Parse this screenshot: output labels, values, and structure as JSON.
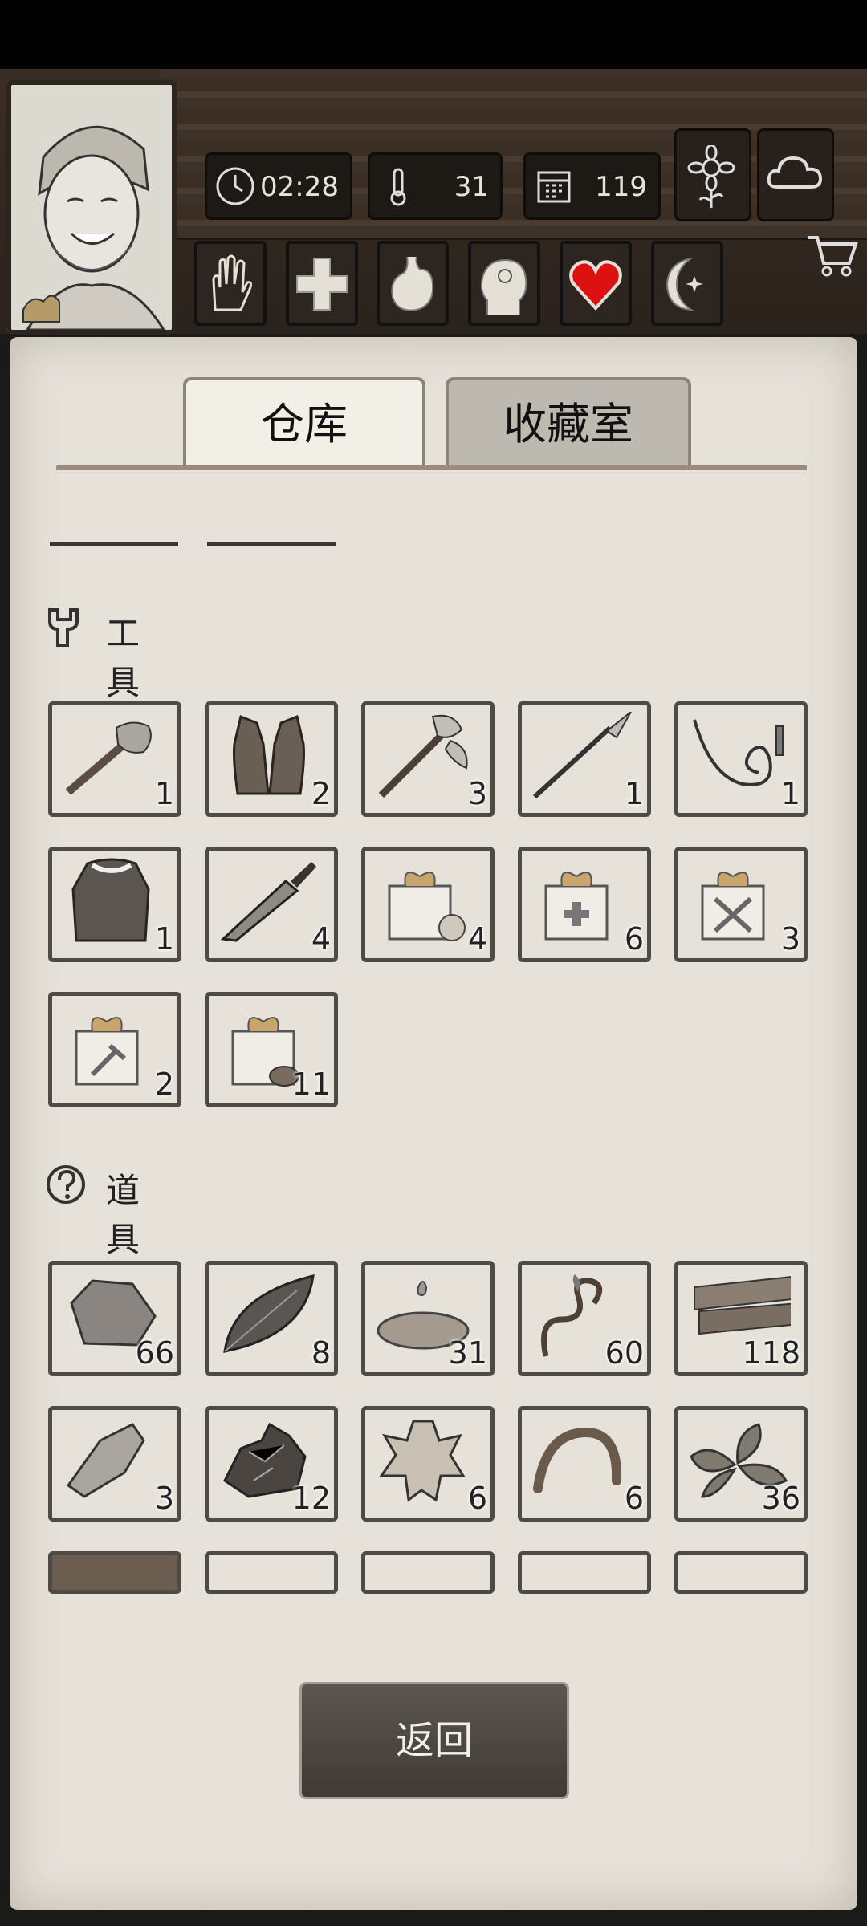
{
  "hud": {
    "time": "02:28",
    "temperature": "31",
    "days": "119",
    "top_buttons": [
      "sunflower-icon",
      "cloud-icon"
    ],
    "status_icons": [
      "hand-icon",
      "medical-cross-icon",
      "stomach-icon",
      "head-icon",
      "heart-icon",
      "moon-star-icon"
    ]
  },
  "tabs": {
    "warehouse": "仓库",
    "collection": "收藏室"
  },
  "sections": {
    "tools": {
      "title": "工具",
      "items": [
        {
          "icon": "stone-axe-icon",
          "count": "1"
        },
        {
          "icon": "leather-vest-icon",
          "count": "2"
        },
        {
          "icon": "battle-axe-icon",
          "count": "3"
        },
        {
          "icon": "spear-icon",
          "count": "1"
        },
        {
          "icon": "whip-icon",
          "count": "1"
        },
        {
          "icon": "fur-coat-icon",
          "count": "1"
        },
        {
          "icon": "machete-icon",
          "count": "4"
        },
        {
          "icon": "food-gift-box-icon",
          "count": "4"
        },
        {
          "icon": "medical-gift-box-icon",
          "count": "6"
        },
        {
          "icon": "weapon-gift-box-icon",
          "count": "3"
        },
        {
          "icon": "tool-gift-box-icon",
          "count": "2"
        },
        {
          "icon": "wood-gift-box-icon",
          "count": "11"
        }
      ]
    },
    "props": {
      "title": "道具",
      "items": [
        {
          "icon": "stone-icon",
          "count": "66"
        },
        {
          "icon": "leaf-icon",
          "count": "8"
        },
        {
          "icon": "water-puddle-icon",
          "count": "31"
        },
        {
          "icon": "vine-icon",
          "count": "60"
        },
        {
          "icon": "wood-planks-icon",
          "count": "118"
        },
        {
          "icon": "flint-icon",
          "count": "3"
        },
        {
          "icon": "ore-icon",
          "count": "12"
        },
        {
          "icon": "animal-hide-icon",
          "count": "6"
        },
        {
          "icon": "worm-icon",
          "count": "6"
        },
        {
          "icon": "herb-icon",
          "count": "36"
        }
      ]
    }
  },
  "back_label": "返回"
}
